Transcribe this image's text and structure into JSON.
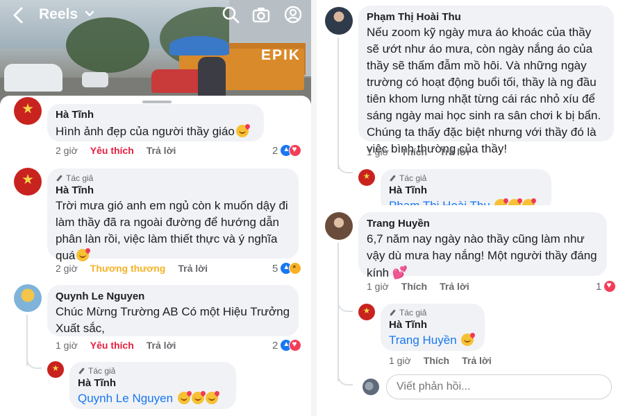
{
  "header": {
    "title": "Reels",
    "watermark": "EPIK"
  },
  "left_comments": [
    {
      "author": "Hà Tĩnh",
      "text": "Hình ảnh đẹp của người thầy giáo",
      "time": "2 giờ",
      "reaction_label": "Yêu thích",
      "reply_label": "Trả lời",
      "reaction_count": "2"
    },
    {
      "author_tag": "Tác giả",
      "author": "Hà Tĩnh",
      "text": "Trời mưa gió anh em ngủ còn k muốn dậy đi làm thầy đã ra ngoài đường để hướng dẫn phân làn rồi, việc làm thiết thực và ý nghĩa quá",
      "time": "2 giờ",
      "reaction_label": "Thương thương",
      "reply_label": "Trả lời",
      "reaction_count": "5"
    },
    {
      "author": "Quynh Le Nguyen",
      "text": "Chúc Mừng Trường AB Có một Hiệu Trưởng Xuất sắc,",
      "time": "1 giờ",
      "reaction_label": "Yêu thích",
      "reply_label": "Trả lời",
      "reaction_count": "2"
    },
    {
      "author_tag": "Tác giả",
      "author": "Hà Tĩnh",
      "mention": "Quynh Le Nguyen"
    }
  ],
  "right_comments": [
    {
      "author": "Phạm Thị Hoài Thu",
      "text": "Nếu zoom kỹ ngày mưa áo khoác của thầy sẽ ướt như áo mưa, còn ngày nắng áo của thầy sẽ thấm đẫm mồ hôi. Và những ngày trường có hoạt động buổi tối, thầy là ng đầu tiên khom lưng nhặt từng cái rác nhỏ xíu để sáng ngày mai học sinh ra sân chơi k bị bẩn. Chúng ta thấy đặc biệt nhưng với thầy đó là việc bình thường của thầy!",
      "time": "1 giờ",
      "like_label": "Thích",
      "reply_label": "Trả lời"
    },
    {
      "author_tag": "Tác giả",
      "author": "Hà Tĩnh",
      "mention": "Phạm Thị Hoài Thu"
    },
    {
      "author": "Trang Huyền",
      "text": "6,7 năm nay ngày nào thầy cũng làm như vậy dù mưa hay nắng! Một người thầy đáng kính",
      "time": "1 giờ",
      "like_label": "Thích",
      "reply_label": "Trả lời",
      "reaction_count": "1"
    },
    {
      "author_tag": "Tác giả",
      "author": "Hà Tĩnh",
      "mention": "Trang Huyền",
      "time": "1 giờ",
      "like_label": "Thích",
      "reply_label": "Trả lời"
    }
  ],
  "reply_box": {
    "placeholder": "Viết phản hồi..."
  },
  "icons": [
    "back-icon",
    "chevron-down-icon",
    "search-icon",
    "camera-icon",
    "profile-icon",
    "pencil-icon",
    "like-reaction-icon",
    "love-reaction-icon",
    "care-reaction-icon",
    "care-emoji-icon",
    "pink-heart-emoji-icon"
  ],
  "colors": {
    "link_blue": "#1877f2",
    "love_red": "#e41e3f",
    "care_yellow": "#f7b125",
    "bubble_bg": "#f0f2f5"
  }
}
